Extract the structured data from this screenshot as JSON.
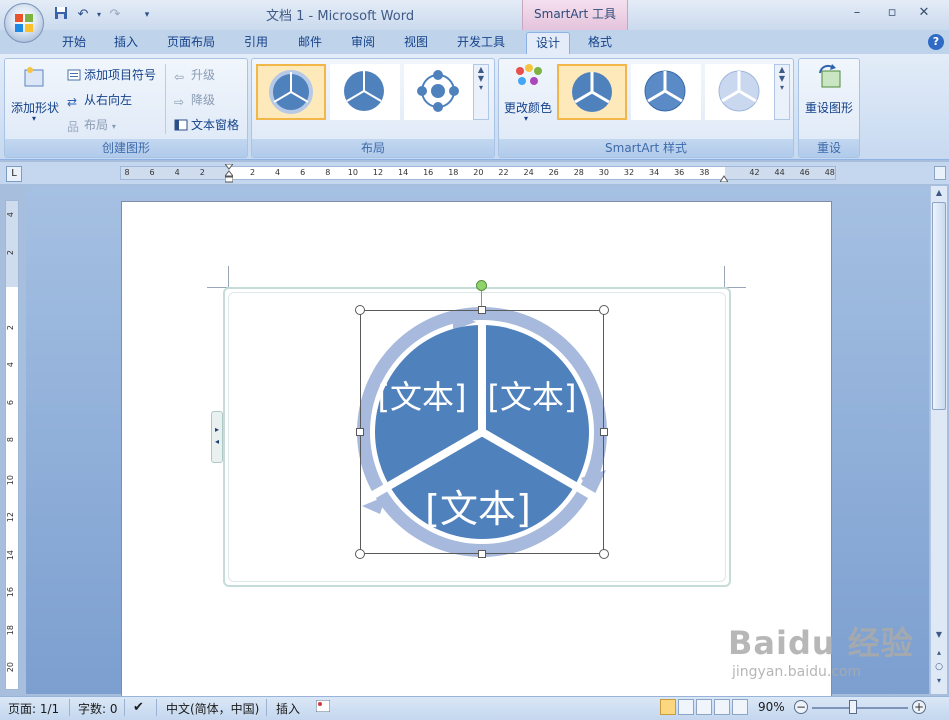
{
  "window": {
    "title": "文档 1 - Microsoft Word",
    "context_tab_title": "SmartArt 工具"
  },
  "quick_access": [
    "save-icon",
    "undo-icon",
    "redo-icon",
    "customize-icon"
  ],
  "tabs": [
    {
      "label": "开始"
    },
    {
      "label": "插入"
    },
    {
      "label": "页面布局"
    },
    {
      "label": "引用"
    },
    {
      "label": "邮件"
    },
    {
      "label": "审阅"
    },
    {
      "label": "视图"
    },
    {
      "label": "开发工具"
    },
    {
      "label": "设计",
      "active": true
    },
    {
      "label": "格式"
    }
  ],
  "ribbon": {
    "create_group": {
      "label": "创建图形",
      "add_shape": "添加形状",
      "add_bullet": "添加项目符号",
      "right_to_left": "从右向左",
      "layout": "布局",
      "promote": "升级",
      "demote": "降级",
      "text_pane": "文本窗格"
    },
    "layout_group": {
      "label": "布局"
    },
    "styles_group": {
      "label": "SmartArt 样式",
      "change_colors": "更改颜色"
    },
    "reset_group": {
      "label": "重设",
      "reset_graphic": "重设图形"
    }
  },
  "ruler": {
    "h_ticks": [
      "8",
      "6",
      "4",
      "2",
      "",
      "2",
      "4",
      "6",
      "8",
      "10",
      "12",
      "14",
      "16",
      "18",
      "20",
      "22",
      "24",
      "26",
      "28",
      "30",
      "32",
      "34",
      "36",
      "38",
      "",
      "42",
      "44",
      "46",
      "48"
    ],
    "v_ticks": [
      "4",
      "2",
      "",
      "2",
      "4",
      "6",
      "8",
      "10",
      "12",
      "14",
      "16",
      "18",
      "20"
    ]
  },
  "smartart": {
    "segments": [
      "[文本]",
      "[文本]",
      "[文本]"
    ]
  },
  "status": {
    "page": "页面: 1/1",
    "words": "字数: 0",
    "language": "中文(简体，中国)",
    "mode": "插入",
    "zoom": "90%"
  },
  "watermark": {
    "brand": "Baidu 经验",
    "url": "jingyan.baidu.com"
  },
  "colors": {
    "smartart_fill": "#4f81bd",
    "smartart_arrow": "#a7b9dc",
    "ribbon_bg": "#d2e1f4",
    "context_tab": "#e5c3dc"
  }
}
